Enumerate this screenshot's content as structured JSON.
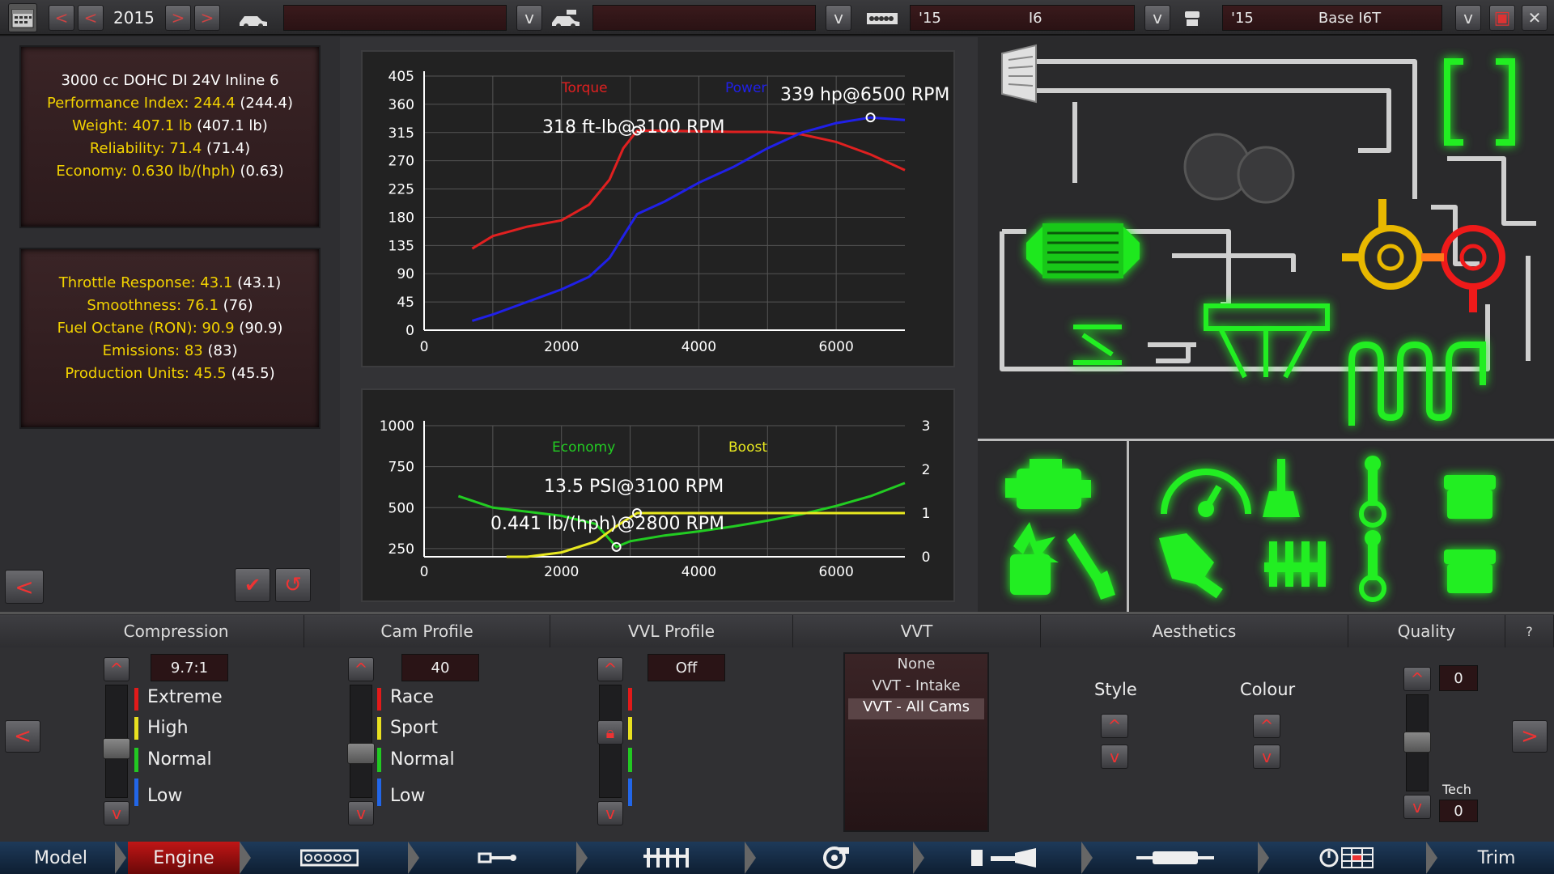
{
  "topbar": {
    "year": "2015",
    "model_field": "",
    "trim_field": "",
    "engine_year": "'15",
    "engine_name": "I6",
    "variant_year": "'15",
    "variant_name": "Base I6T"
  },
  "engine_stats": {
    "title": "3000 cc DOHC DI 24V Inline 6",
    "lines": [
      {
        "label": "Performance Index: 244.4",
        "paren": "(244.4)"
      },
      {
        "label": "Weight: 407.1 lb",
        "paren": "(407.1 lb)"
      },
      {
        "label": "Reliability: 71.4",
        "paren": "(71.4)"
      },
      {
        "label": "Economy: 0.630 lb/(hph)",
        "paren": "(0.63)"
      }
    ]
  },
  "engine_stats2": {
    "lines": [
      {
        "label": "Throttle Response: 43.1",
        "paren": "(43.1)"
      },
      {
        "label": "Smoothness: 76.1",
        "paren": "(76)"
      },
      {
        "label": "Fuel Octane (RON): 90.9",
        "paren": "(90.9)"
      },
      {
        "label": "Emissions: 83",
        "paren": "(83)"
      },
      {
        "label": "Production Units: 45.5",
        "paren": "(45.5)"
      }
    ]
  },
  "colors": {
    "torque": "#e02020",
    "power": "#2020e8",
    "economy": "#22cc22",
    "boost": "#e8e820",
    "stat": "#f2d200"
  },
  "chart_data": [
    {
      "type": "line",
      "title": "",
      "xlabel": "",
      "ylabel": "",
      "xlim": [
        0,
        7000
      ],
      "ylim": [
        0,
        405
      ],
      "xticks": [
        "0",
        "2000",
        "4000",
        "6000"
      ],
      "yticks": [
        "0",
        "45",
        "90",
        "135",
        "180",
        "225",
        "270",
        "315",
        "360",
        "405"
      ],
      "legend": [
        "Torque",
        "Power"
      ],
      "annotations": [
        "318 ft-lb@3100 RPM",
        "339 hp@6500 RPM"
      ],
      "series": [
        {
          "name": "Torque",
          "x": [
            700,
            1000,
            1500,
            2000,
            2400,
            2700,
            2900,
            3100,
            3500,
            4000,
            4500,
            5000,
            5500,
            6000,
            6500,
            7000
          ],
          "y": [
            130,
            150,
            165,
            175,
            200,
            240,
            290,
            318,
            318,
            317,
            316,
            316,
            312,
            300,
            280,
            255
          ]
        },
        {
          "name": "Power",
          "x": [
            700,
            1000,
            1500,
            2000,
            2400,
            2700,
            2900,
            3100,
            3500,
            4000,
            4500,
            5000,
            5500,
            6000,
            6500,
            7000
          ],
          "y": [
            15,
            25,
            45,
            65,
            85,
            115,
            150,
            185,
            205,
            235,
            260,
            290,
            315,
            330,
            339,
            335
          ]
        }
      ]
    },
    {
      "type": "line",
      "title": "",
      "xlabel": "",
      "ylabel": "",
      "xlim": [
        0,
        7000
      ],
      "ylim": [
        0,
        1000
      ],
      "y2lim": [
        0,
        3
      ],
      "xticks": [
        "0",
        "2000",
        "4000",
        "6000"
      ],
      "yticks": [
        "250",
        "500",
        "750",
        "1000"
      ],
      "y2ticks": [
        "0",
        "1",
        "2",
        "3"
      ],
      "legend": [
        "Economy",
        "Boost"
      ],
      "annotations": [
        "13.5 PSI@3100 RPM",
        "0.441 lb/(hph)@2800 RPM"
      ],
      "series": [
        {
          "name": "Economy",
          "x": [
            500,
            1000,
            1500,
            2000,
            2500,
            2800,
            3000,
            3500,
            4000,
            4500,
            5000,
            5500,
            6000,
            6500,
            7000
          ],
          "y": [
            570,
            500,
            475,
            450,
            400,
            260,
            295,
            330,
            355,
            385,
            420,
            460,
            510,
            570,
            650
          ]
        },
        {
          "name": "Boost",
          "axis": "y2",
          "x": [
            1200,
            1500,
            2000,
            2500,
            2800,
            3000,
            3100,
            3500,
            4000,
            5000,
            6000,
            7000
          ],
          "y": [
            0,
            0,
            0.1,
            0.35,
            0.7,
            0.9,
            1.0,
            1.0,
            1.0,
            1.0,
            1.0,
            1.0
          ]
        }
      ]
    }
  ],
  "tuning": {
    "compression": {
      "header": "Compression",
      "value": "9.7:1",
      "levels": [
        "Extreme",
        "High",
        "Normal",
        "Low"
      ]
    },
    "cam": {
      "header": "Cam Profile",
      "value": "40",
      "levels": [
        "Race",
        "Sport",
        "Normal",
        "Low"
      ]
    },
    "vvl": {
      "header": "VVL Profile",
      "value": "Off"
    },
    "vvt": {
      "header": "VVT",
      "options": [
        "None",
        "VVT - Intake",
        "VVT - All Cams"
      ],
      "selected": "VVT - All Cams"
    },
    "aesthetics": {
      "header": "Aesthetics",
      "style_label": "Style",
      "colour_label": "Colour"
    },
    "quality": {
      "header": "Quality",
      "value": "0",
      "tech_label": "Tech",
      "tech_value": "0"
    },
    "help": "?"
  },
  "bottom_nav": {
    "model": "Model",
    "engine": "Engine",
    "trim": "Trim"
  }
}
